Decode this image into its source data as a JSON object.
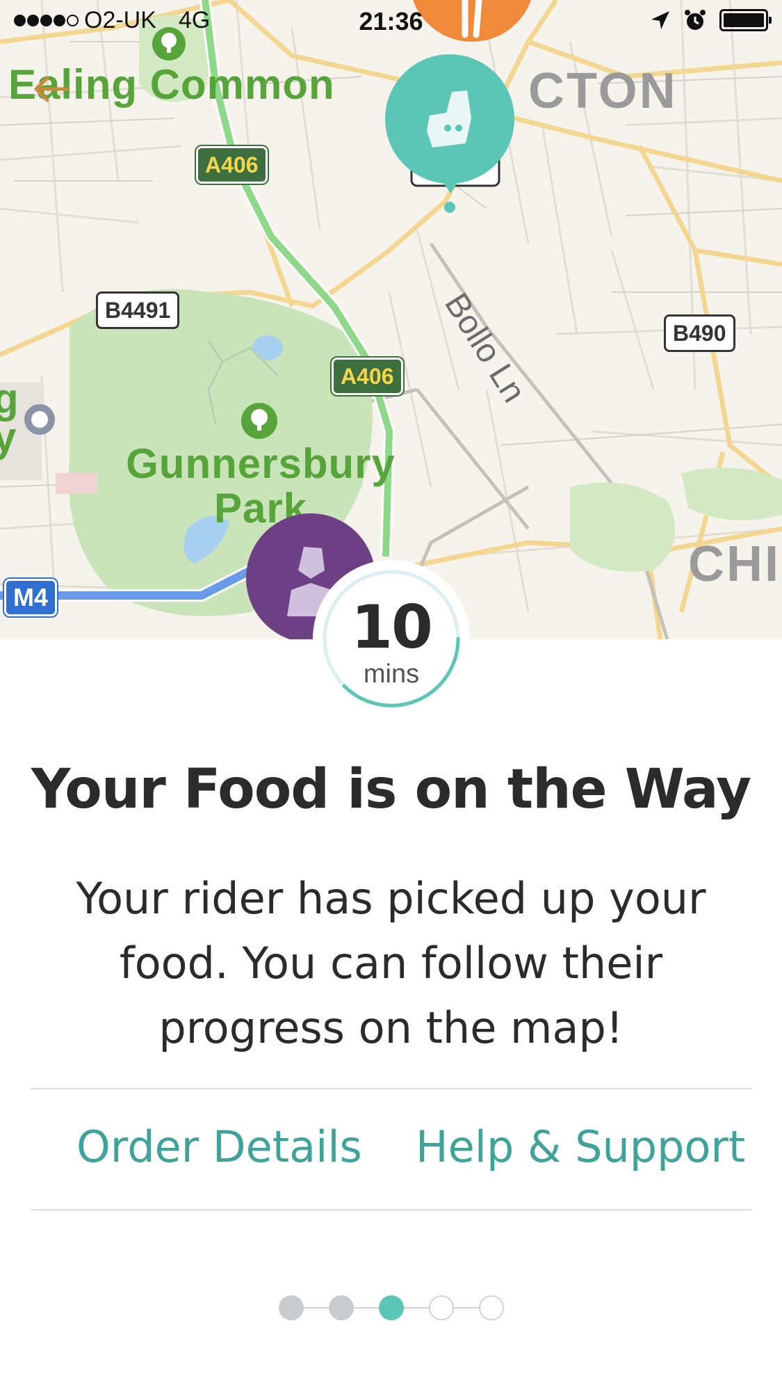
{
  "status_bar": {
    "carrier": "O2-UK",
    "network": "4G",
    "time": "21:36",
    "signal_bars_filled": 4,
    "signal_bars_total": 5,
    "icons": [
      "location-arrow-icon",
      "alarm-icon",
      "battery-icon"
    ]
  },
  "map": {
    "labels": {
      "ealing_common": "Ealing Common",
      "gunnersbury_park": "Gunnersbury Park",
      "acton_partial": "CTON",
      "chiswick_partial": "CHI",
      "bollo_ln": "Bollo Ln",
      "left_edge_partial": "g y"
    },
    "road_shields": {
      "a406_top": "A406",
      "a406_middle": "A406",
      "b4491": "B4491",
      "b490": "B490",
      "m4": "M4"
    },
    "pins": {
      "restaurant": "fork-knife-icon",
      "deliveroo": "deliveroo-logo-icon",
      "rider": "rider-person-icon"
    },
    "colors": {
      "map_background": "#f6f3ec",
      "park": "#c8e4b8",
      "route_green": "#8ed88a",
      "route_blue": "#6a9be8",
      "restaurant_pin": "#f0893a",
      "deliveroo_pin": "#5cc6b6",
      "rider_pin": "#6d3f85"
    }
  },
  "timer": {
    "value": "10",
    "unit": "mins"
  },
  "headline": "Your Food is on the Way",
  "message": "Your rider has picked up your food. You can follow their progress on the map!",
  "actions": {
    "order_details": "Order Details",
    "help_support": "Help & Support"
  },
  "progress": {
    "total_steps": 5,
    "current_step": 3
  },
  "colors": {
    "accent": "#40a39a",
    "teal": "#5cc6b6",
    "text": "#2b2b2b"
  }
}
